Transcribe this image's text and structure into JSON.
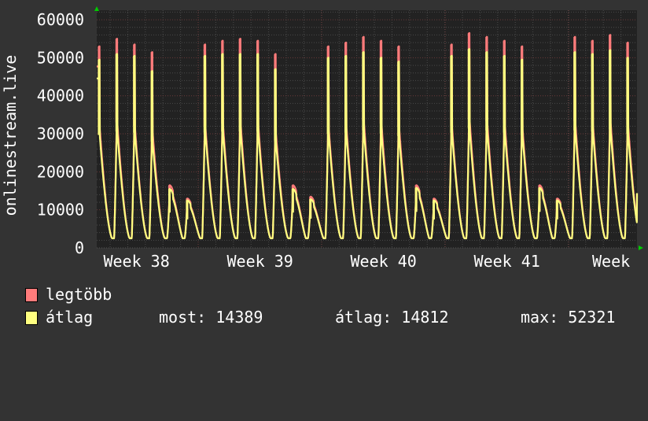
{
  "chart_data": {
    "type": "line",
    "title": "",
    "ylabel": "onlinestream.live",
    "xlabel": "",
    "ylim": [
      0,
      62500
    ],
    "xlim_days": [
      0,
      30.67
    ],
    "yticks": [
      0,
      10000,
      20000,
      30000,
      40000,
      50000,
      60000
    ],
    "ytick_labels": [
      "0",
      "10000",
      "20000",
      "30000",
      "40000",
      "50000",
      "60000"
    ],
    "week_boundaries_days": [
      5.76,
      12.77,
      19.78,
      26.79
    ],
    "xtick_labels": [
      {
        "label": "Week 38",
        "day": 2.26
      },
      {
        "label": "Week 39",
        "day": 9.27
      },
      {
        "label": "Week 40",
        "day": 16.28
      },
      {
        "label": "Week 41",
        "day": 23.29
      },
      {
        "label": "Week",
        "day": 29.2
      }
    ],
    "first_peak_day": 0.13,
    "daily_base": 2500,
    "end_value": 14389,
    "series": [
      {
        "name": "legtöbb",
        "color": "#ff7b7b",
        "daily_peaks": [
          53000,
          55000,
          53500,
          51500,
          16500,
          13000,
          53500,
          54500,
          55000,
          54500,
          51000,
          16500,
          13500,
          53000,
          54000,
          55500,
          54500,
          53000,
          16500,
          13000,
          53500,
          56500,
          55500,
          54500,
          53000,
          16500,
          13000,
          55500,
          54500,
          56000,
          54000
        ]
      },
      {
        "name": "átlag",
        "color": "#ffff80",
        "daily_peaks": [
          49500,
          51000,
          50500,
          46500,
          15500,
          12500,
          50500,
          51000,
          51000,
          51000,
          47000,
          15500,
          12800,
          50000,
          50500,
          51500,
          50000,
          49000,
          15800,
          12500,
          50500,
          52300,
          51500,
          50500,
          49500,
          15800,
          12500,
          51500,
          51000,
          52000,
          50000
        ]
      }
    ]
  },
  "legend": {
    "items": [
      {
        "label": "legtöbb",
        "color": "#ff7b7b"
      },
      {
        "label": "átlag",
        "color": "#ffff80"
      }
    ],
    "stats": {
      "most": "most: 14389",
      "atlag": "átlag: 14812",
      "max": "max: 52321"
    }
  }
}
